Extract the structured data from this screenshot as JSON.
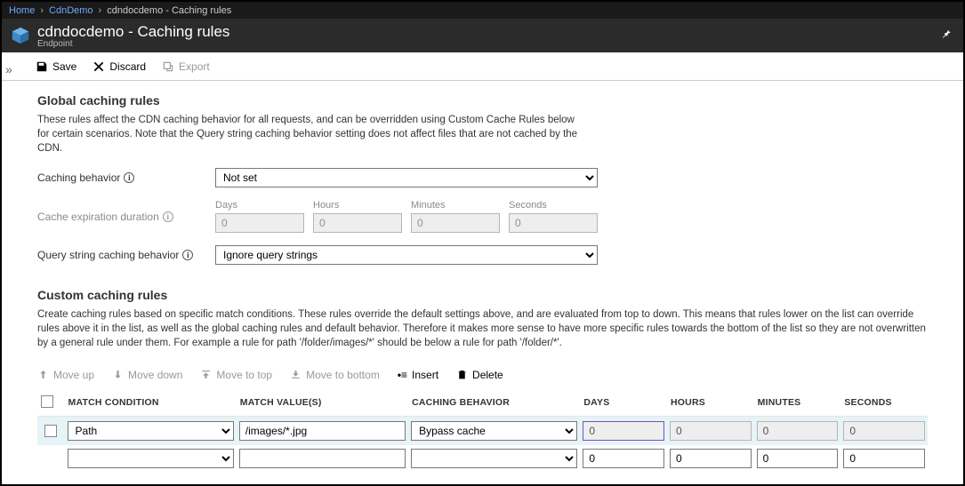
{
  "breadcrumb": {
    "home": "Home",
    "item1": "CdnDemo",
    "item2": "cdndocdemo - Caching rules"
  },
  "title": {
    "main": "cdndocdemo - Caching rules",
    "sub": "Endpoint"
  },
  "toolbar": {
    "save": "Save",
    "discard": "Discard",
    "export": "Export"
  },
  "global": {
    "heading": "Global caching rules",
    "desc": "These rules affect the CDN caching behavior for all requests, and can be overridden using Custom Cache Rules below for certain scenarios. Note that the Query string caching behavior setting does not affect files that are not cached by the CDN.",
    "caching_label": "Caching behavior",
    "caching_value": "Not set",
    "expiration_label": "Cache expiration duration",
    "dur_days_label": "Days",
    "dur_days_val": "0",
    "dur_hours_label": "Hours",
    "dur_hours_val": "0",
    "dur_min_label": "Minutes",
    "dur_min_val": "0",
    "dur_sec_label": "Seconds",
    "dur_sec_val": "0",
    "query_label": "Query string caching behavior",
    "query_value": "Ignore query strings"
  },
  "custom": {
    "heading": "Custom caching rules",
    "desc": "Create caching rules based on specific match conditions. These rules override the default settings above, and are evaluated from top to down. This means that rules lower on the list can override rules above it in the list, as well as the global caching rules and default behavior. Therefore it makes more sense to have more specific rules towards the bottom of the list so they are not overwritten by a general rule under them. For example a rule for path '/folder/images/*' should be below a rule for path '/folder/*'.",
    "toolbar": {
      "move_up": "Move up",
      "move_down": "Move down",
      "move_top": "Move to top",
      "move_bottom": "Move to bottom",
      "insert": "Insert",
      "delete": "Delete"
    },
    "headers": {
      "match_condition": "MATCH CONDITION",
      "match_values": "MATCH VALUE(S)",
      "caching_behavior": "CACHING BEHAVIOR",
      "days": "DAYS",
      "hours": "HOURS",
      "minutes": "MINUTES",
      "seconds": "SECONDS"
    },
    "rows": [
      {
        "match_condition": "Path",
        "match_value": "/images/*.jpg",
        "caching_behavior": "Bypass cache",
        "days": "0",
        "hours": "0",
        "minutes": "0",
        "seconds": "0",
        "disabled_durations": true,
        "selected": true
      },
      {
        "match_condition": "",
        "match_value": "",
        "caching_behavior": "",
        "days": "0",
        "hours": "0",
        "minutes": "0",
        "seconds": "0",
        "disabled_durations": false,
        "selected": false
      }
    ]
  }
}
